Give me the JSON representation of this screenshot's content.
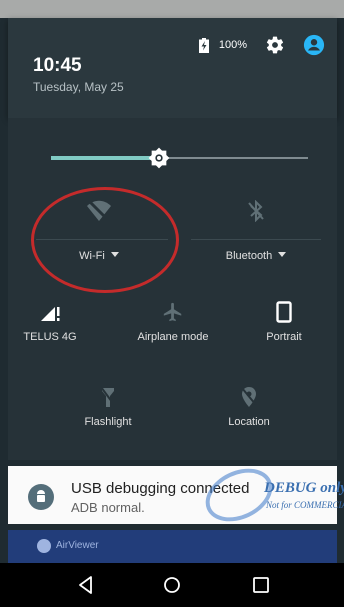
{
  "status": {
    "battery_text": "100%"
  },
  "header": {
    "time": "10:45",
    "date": "Tuesday, May 25"
  },
  "brightness": {
    "level": 0.42
  },
  "tiles": {
    "wifi": {
      "label": "Wi-Fi",
      "icon": "wifi-off-icon"
    },
    "bluetooth": {
      "label": "Bluetooth",
      "icon": "bluetooth-off-icon"
    },
    "cellular": {
      "label": "TELUS 4G",
      "icon": "signal-icon"
    },
    "airplane": {
      "label": "Airplane mode",
      "icon": "airplane-icon"
    },
    "rotation": {
      "label": "Portrait",
      "icon": "phone-portrait-icon"
    },
    "flashlight": {
      "label": "Flashlight",
      "icon": "flashlight-icon"
    },
    "location": {
      "label": "Location",
      "icon": "location-off-icon"
    }
  },
  "notification": {
    "title": "USB debugging connected",
    "text": "ADB normal.",
    "watermark": {
      "title": "DEBUG only",
      "subtitle": "Not for COMMERCIAL"
    }
  },
  "peek_app": {
    "label": "AirViewer"
  },
  "colors": {
    "accent": "#80cbc4",
    "annotation": "#c42b2b",
    "panel": "#263238"
  }
}
